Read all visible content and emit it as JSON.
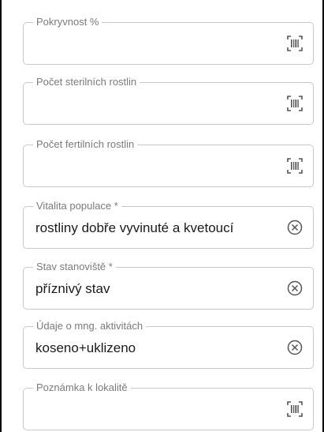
{
  "fields": [
    {
      "label": "Pokryvnost %",
      "value": "",
      "icon": "barcode-icon"
    },
    {
      "label": "Počet sterilních rostlin",
      "value": "",
      "icon": "barcode-icon"
    },
    {
      "label": "Počet fertilních rostlin",
      "value": "",
      "icon": "barcode-icon"
    },
    {
      "label": "Vitalita populace *",
      "value": "rostliny dobře vyvinuté a kvetoucí",
      "icon": "clear-icon"
    },
    {
      "label": "Stav stanoviště *",
      "value": "příznivý stav",
      "icon": "clear-icon"
    },
    {
      "label": "Údaje o mng. aktivitách",
      "value": "koseno+uklizeno",
      "icon": "clear-icon"
    },
    {
      "label": "Poznámka k lokalitě",
      "value": "",
      "icon": "barcode-icon"
    }
  ]
}
